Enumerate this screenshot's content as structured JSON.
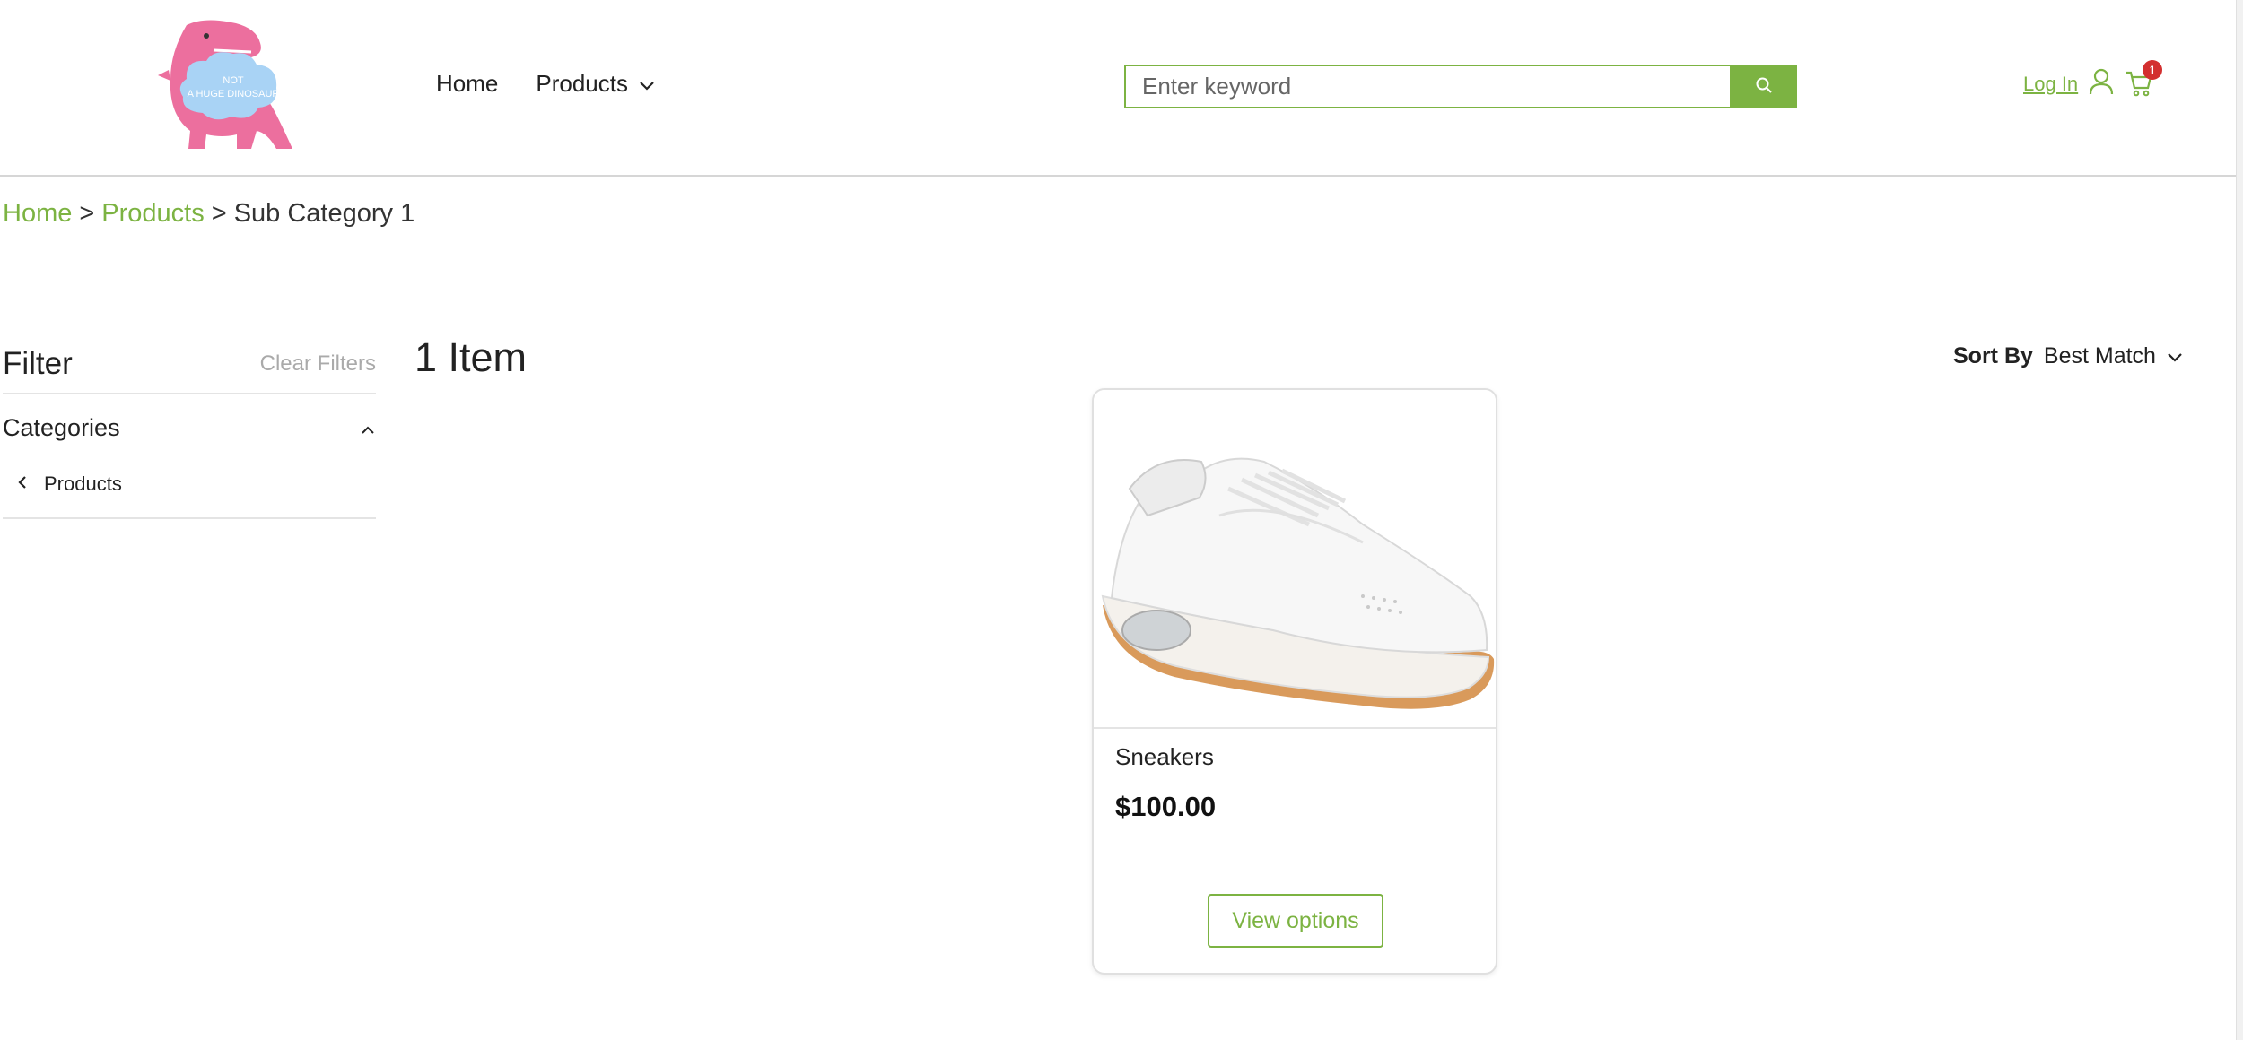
{
  "logo": {
    "text_line1": "NOT",
    "text_line2": "A HUGE DINOSAUR"
  },
  "nav": {
    "home": "Home",
    "products": "Products"
  },
  "search": {
    "placeholder": "Enter keyword"
  },
  "account": {
    "login": "Log In",
    "cart_count": "1"
  },
  "breadcrumb": {
    "home": "Home",
    "sep1": ">",
    "products": "Products",
    "sep2": ">",
    "current": "Sub Category 1"
  },
  "sidebar": {
    "filter_title": "Filter",
    "clear_filters": "Clear Filters",
    "categories_title": "Categories",
    "items": [
      {
        "label": "Products"
      }
    ]
  },
  "results": {
    "count": "1 Item",
    "sort_label": "Sort By",
    "sort_value": "Best Match"
  },
  "product": {
    "name": "Sneakers",
    "price": "$100.00",
    "button": "View options"
  },
  "colors": {
    "accent": "#7cb342",
    "badge": "#d32f2f",
    "logo_pink": "#ec6f9e",
    "logo_cloud": "#a9d3f5"
  }
}
